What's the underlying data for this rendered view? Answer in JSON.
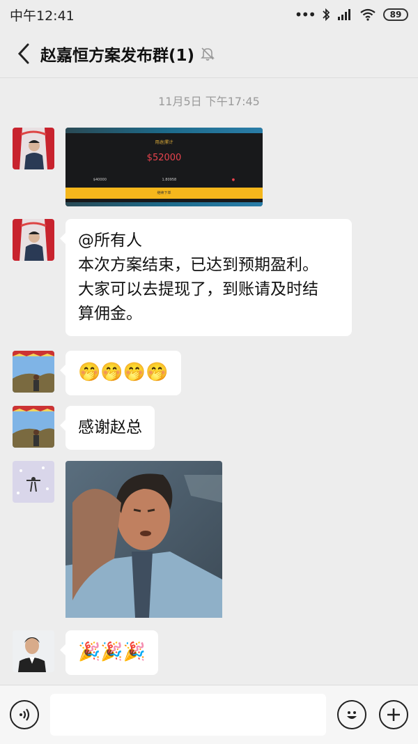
{
  "status_bar": {
    "time": "中午12:41",
    "battery": "89"
  },
  "header": {
    "title": "赵嘉恒方案发布群(1)"
  },
  "chat": {
    "timestamp": "11月5日 下午17:45",
    "screenshot": {
      "sub_label": "用途|累计",
      "amount": "$52000",
      "col1": "$40000",
      "col2": "1.80958",
      "btn_label": "继续下单"
    },
    "announcement_lines": [
      "@所有人",
      "本次方案结束，已达到预期盈利。",
      "大家可以去提现了，到账请及时结",
      "算佣金。"
    ],
    "emoji_message": "🤭🤭🤭🤭",
    "thanks_message": "感谢赵总",
    "party_message": "🎉🎉🎉"
  },
  "colors": {
    "background": "#ededed",
    "bubble": "#ffffff",
    "amount_red": "#e8434d",
    "accent_yellow": "#f5b71c"
  }
}
